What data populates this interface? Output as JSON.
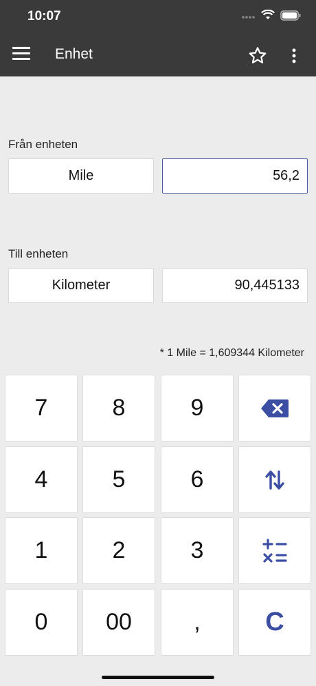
{
  "status": {
    "time": "10:07"
  },
  "toolbar": {
    "title": "Enhet"
  },
  "from": {
    "label": "Från enheten",
    "unit": "Mile",
    "value": "56,2"
  },
  "to": {
    "label": "Till enheten",
    "unit": "Kilometer",
    "value": "90,445133"
  },
  "conversion_note": "* 1 Mile = 1,609344 Kilometer",
  "keypad": {
    "k7": "7",
    "k8": "8",
    "k9": "9",
    "k4": "4",
    "k5": "5",
    "k6": "6",
    "k1": "1",
    "k2": "2",
    "k3": "3",
    "k0": "0",
    "k00": "00",
    "comma": ",",
    "clear": "C"
  },
  "colors": {
    "bar": "#3a3a3a",
    "accent": "#3b4ea3",
    "background": "#ececec"
  },
  "icons": [
    "menu-icon",
    "star-icon",
    "more-vert-icon",
    "backspace-icon",
    "swap-icon",
    "calculator-ops-icon",
    "wifi-icon",
    "battery-icon",
    "signal-icon"
  ]
}
